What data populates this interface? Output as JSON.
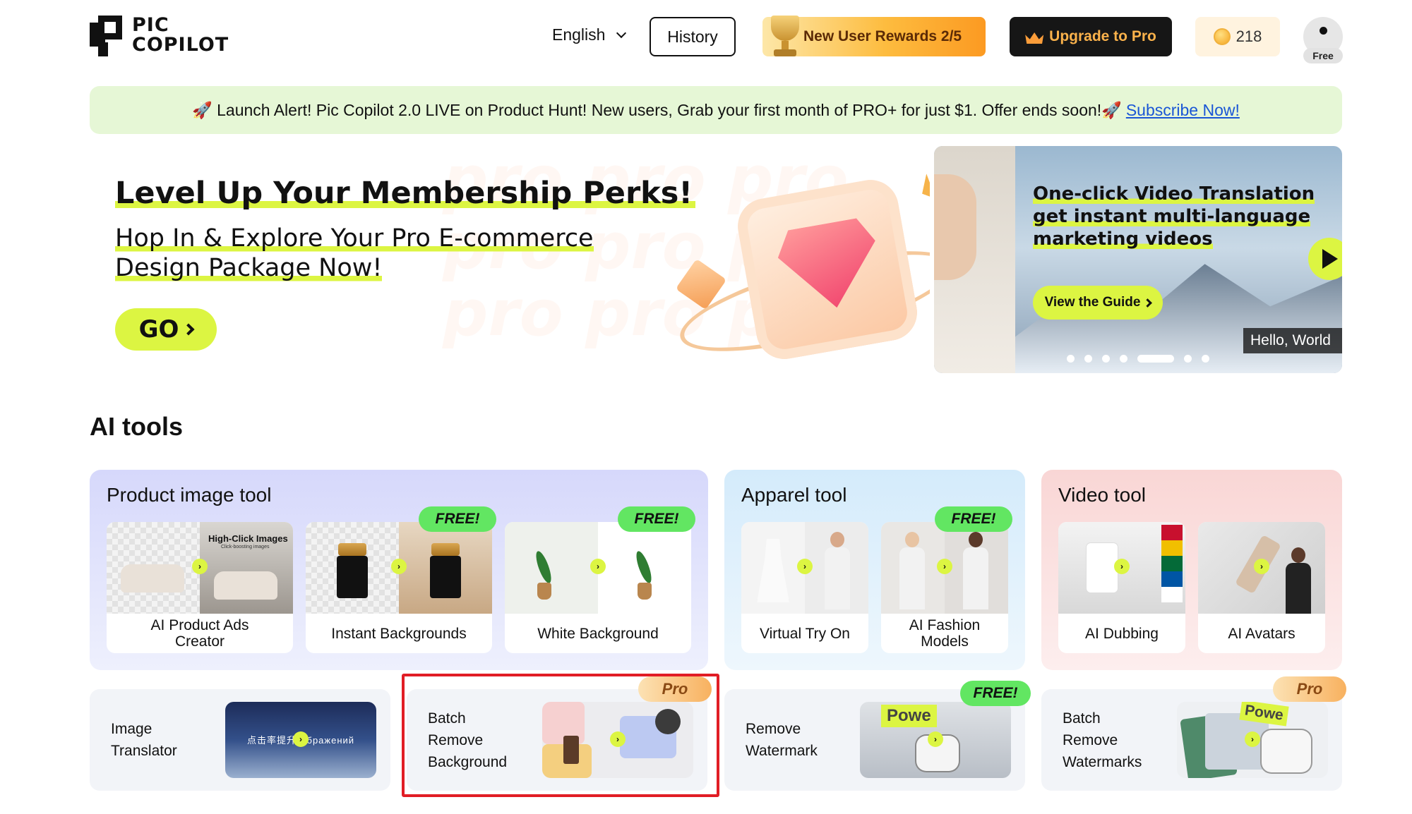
{
  "header": {
    "logo_line1": "PIC",
    "logo_line2": "COPILOT",
    "language": "English",
    "history_label": "History",
    "rewards_label": "New User Rewards 2/5",
    "upgrade_label": "Upgrade to Pro",
    "credits": "218",
    "plan_badge": "Free"
  },
  "announcement": {
    "text": "🚀 Launch Alert! Pic Copilot 2.0 LIVE on Product Hunt! New users, Grab your first month of PRO+ for just $1. Offer ends soon!🚀",
    "link_label": "Subscribe Now!"
  },
  "hero": {
    "title": "Level Up Your Membership Perks!",
    "subtitle_line1": "Hop In & Explore Your Pro E-commerce",
    "subtitle_line2": "Design Package Now!",
    "go_label": "GO",
    "bg_text": "pro pro pro"
  },
  "video_banner": {
    "title_line1": "One-click Video Translation",
    "title_line2": "get instant multi-language",
    "title_line3": "marketing videos",
    "guide_label": "View the Guide",
    "caption": "Hello, World",
    "slides": 7,
    "active_slide": 4
  },
  "ai_tools": {
    "section_title": "AI tools",
    "categories": [
      {
        "title": "Product image tool",
        "tools": [
          {
            "label_line1": "AI Product Ads",
            "label_line2": "Creator",
            "thumb_text1": "High-Click Images",
            "thumb_text2": "Click-boosting images"
          },
          {
            "label": "Instant Backgrounds",
            "badge": "FREE!"
          },
          {
            "label": "White Background",
            "badge": "FREE!"
          }
        ]
      },
      {
        "title": "Apparel tool",
        "tools": [
          {
            "label": "Virtual Try On"
          },
          {
            "label_line1": "AI Fashion",
            "label_line2": "Models",
            "badge": "FREE!"
          }
        ]
      },
      {
        "title": "Video tool",
        "tools": [
          {
            "label": "AI Dubbing"
          },
          {
            "label": "AI Avatars"
          }
        ]
      }
    ],
    "more_tools": [
      {
        "line1": "Image",
        "line2": "Translator",
        "thumb_text": "点击率提升 ·  бражений"
      },
      {
        "line1": "Batch",
        "line2": "Remove",
        "line3": "Background",
        "badge": "Pro",
        "highlighted": true
      },
      {
        "line1": "Remove",
        "line2": "Watermark",
        "badge": "FREE!",
        "thumb_text": "Powe"
      },
      {
        "line1": "Batch",
        "line2": "Remove",
        "line3": "Watermarks",
        "badge": "Pro",
        "thumb_text": "Powe"
      }
    ]
  },
  "colors": {
    "accent_lime": "#dcf542",
    "free_badge": "#62e662",
    "pro_badge": "#f8b15f",
    "highlight_border": "#e11d25"
  }
}
